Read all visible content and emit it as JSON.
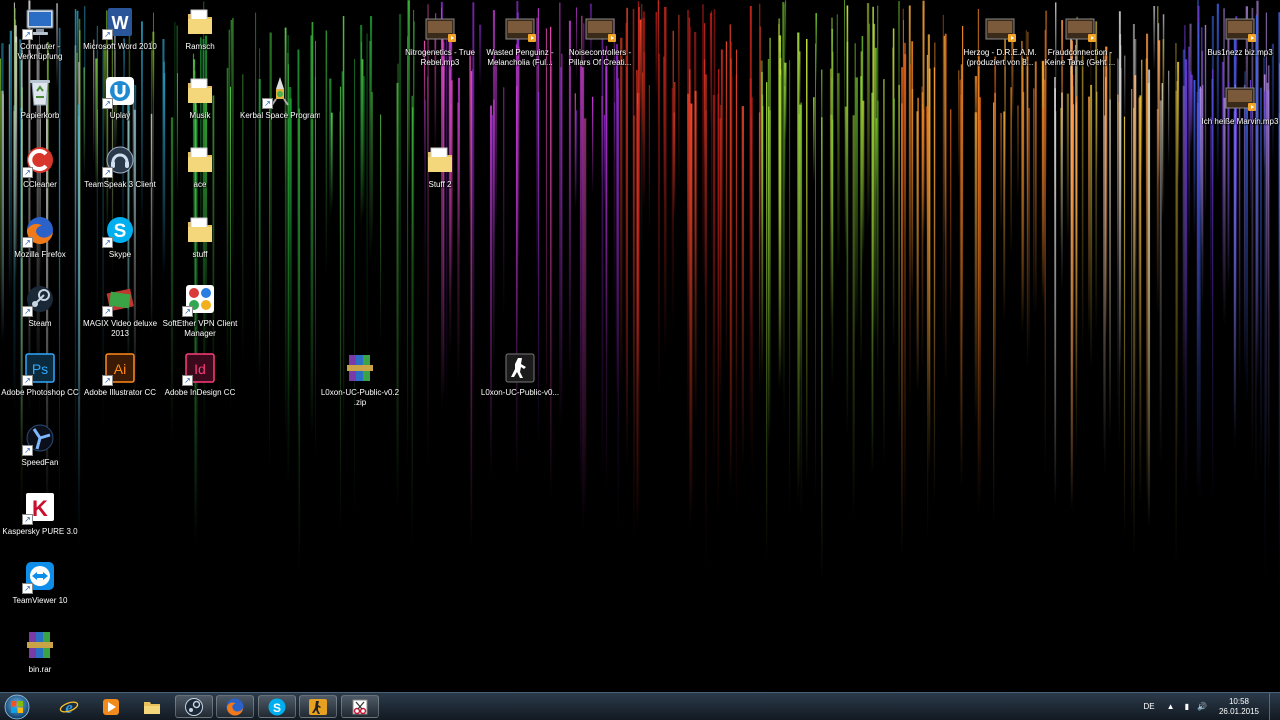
{
  "desktop": {
    "icons": [
      {
        "label_lines": [
          "Computer -",
          "Verknüpfung"
        ],
        "icon": "computer-icon",
        "shortcut": true
      },
      {
        "label_lines": [
          "Microsoft Word 2010"
        ],
        "icon": "word-icon",
        "shortcut": true
      },
      {
        "label_lines": [
          "Ramsch"
        ],
        "icon": "folder-icon",
        "shortcut": false
      },
      {
        "label_lines": [
          "Papierkorb"
        ],
        "icon": "recycle-bin-icon",
        "shortcut": false
      },
      {
        "label_lines": [
          "Uplay"
        ],
        "icon": "uplay-icon",
        "shortcut": true
      },
      {
        "label_lines": [
          "Musik"
        ],
        "icon": "folder-icon",
        "shortcut": false
      },
      {
        "label_lines": [
          "Kerbal Space Program"
        ],
        "icon": "kerbal-icon",
        "shortcut": true
      },
      {
        "label_lines": [
          "CCleaner"
        ],
        "icon": "ccleaner-icon",
        "shortcut": true
      },
      {
        "label_lines": [
          "TeamSpeak 3 Client"
        ],
        "icon": "teamspeak-icon",
        "shortcut": true
      },
      {
        "label_lines": [
          "ace"
        ],
        "icon": "folder-icon",
        "shortcut": false
      },
      {
        "label_lines": [
          "Stuff 2"
        ],
        "icon": "folder-icon",
        "shortcut": false
      },
      {
        "label_lines": [
          "Mozilla Firefox"
        ],
        "icon": "firefox-icon",
        "shortcut": true
      },
      {
        "label_lines": [
          "Skype"
        ],
        "icon": "skype-icon",
        "shortcut": true
      },
      {
        "label_lines": [
          "stuff"
        ],
        "icon": "folder-icon",
        "shortcut": false
      },
      {
        "label_lines": [
          "Steam"
        ],
        "icon": "steam-icon",
        "shortcut": true
      },
      {
        "label_lines": [
          "MAGIX Video deluxe",
          "2013"
        ],
        "icon": "magix-icon",
        "shortcut": true
      },
      {
        "label_lines": [
          "SoftEther VPN Client",
          "Manager"
        ],
        "icon": "softether-icon",
        "shortcut": true
      },
      {
        "label_lines": [
          "Adobe Photoshop CC"
        ],
        "icon": "photoshop-icon",
        "shortcut": true
      },
      {
        "label_lines": [
          "Adobe Illustrator CC"
        ],
        "icon": "illustrator-icon",
        "shortcut": true
      },
      {
        "label_lines": [
          "Adobe InDesign CC"
        ],
        "icon": "indesign-icon",
        "shortcut": true
      },
      {
        "label_lines": [
          "L0xon-UC-Public-v0.2",
          ".zip"
        ],
        "icon": "winrar-icon",
        "shortcut": false
      },
      {
        "label_lines": [
          "L0xon-UC-Public-v0..."
        ],
        "icon": "counter-strike-icon",
        "shortcut": false
      },
      {
        "label_lines": [
          "SpeedFan"
        ],
        "icon": "speedfan-icon",
        "shortcut": true
      },
      {
        "label_lines": [
          "Kaspersky PURE 3.0"
        ],
        "icon": "kaspersky-icon",
        "shortcut": true
      },
      {
        "label_lines": [
          "TeamViewer 10"
        ],
        "icon": "teamviewer-icon",
        "shortcut": true
      },
      {
        "label_lines": [
          "bin.rar"
        ],
        "icon": "winrar-icon",
        "shortcut": false
      },
      {
        "label_lines": [
          "Nitrogenetics - True",
          "Rebel.mp3"
        ],
        "icon": "mp3-icon",
        "shortcut": false
      },
      {
        "label_lines": [
          "Wasted Penguinz -",
          "Melancholia (Ful..."
        ],
        "icon": "mp3-icon",
        "shortcut": false
      },
      {
        "label_lines": [
          "Noisecontrollers -",
          "Pillars Of Creati..."
        ],
        "icon": "mp3-icon",
        "shortcut": false
      },
      {
        "label_lines": [
          "Herzog - D.R.E.A.M.",
          "(produziert von 8..."
        ],
        "icon": "mp3-icon",
        "shortcut": false
      },
      {
        "label_lines": [
          "Fraudconnection -",
          "Keine Tans (Geht ..."
        ],
        "icon": "mp3-icon",
        "shortcut": false
      },
      {
        "label_lines": [
          "Bus1nezz biz.mp3"
        ],
        "icon": "mp3-icon",
        "shortcut": false
      },
      {
        "label_lines": [
          "Ich heiße Marvin.mp3"
        ],
        "icon": "mp3-icon",
        "shortcut": false
      }
    ]
  },
  "taskbar": {
    "start_icon": "windows-start-icon",
    "pinned": [
      {
        "name": "internet-explorer",
        "icon": "internet-explorer-icon",
        "active": false
      },
      {
        "name": "media-player",
        "icon": "media-player-icon",
        "active": false
      },
      {
        "name": "explorer",
        "icon": "folder-icon",
        "active": false
      },
      {
        "name": "steam",
        "icon": "steam-icon",
        "active": true
      },
      {
        "name": "firefox",
        "icon": "firefox-icon",
        "active": true
      },
      {
        "name": "skype",
        "icon": "skype-icon",
        "active": true
      },
      {
        "name": "csgo",
        "icon": "csgo-icon",
        "active": true
      },
      {
        "name": "snipping",
        "icon": "snipping-tool-icon",
        "active": true
      }
    ],
    "tray": {
      "language": "DE",
      "time": "10:58",
      "date": "26.01.2015"
    }
  }
}
